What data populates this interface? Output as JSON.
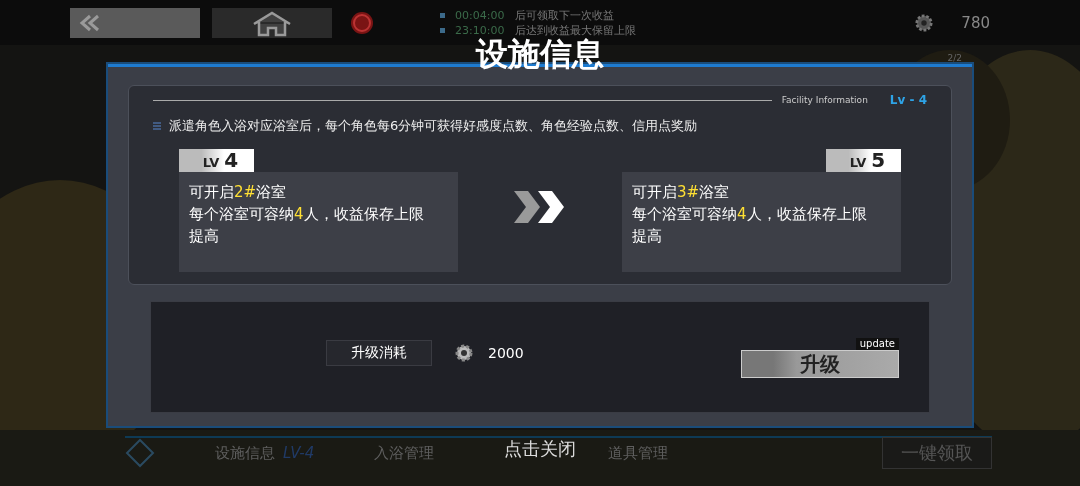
{
  "top_bar": {
    "timers": [
      {
        "time": "00:04:00",
        "text": "后可领取下一次收益"
      },
      {
        "time": "23:10:00",
        "text": "后达到收益最大保留上限"
      }
    ],
    "currency": "780"
  },
  "modal": {
    "title": "设施信息",
    "page": "2/2",
    "subtitle": "Facility Information",
    "level": "Lv - 4",
    "description": "派遣角色入浴对应浴室后，每个角色每6分钟可获得好感度点数、角色经验点数、信用点奖励",
    "cards": [
      {
        "lv_label": "LV",
        "lv": "4",
        "lines": [
          "可开启**2#**浴室",
          "每个浴室可容纳**4**人，收益保存上限提高"
        ]
      },
      {
        "lv_label": "LV",
        "lv": "5",
        "lines": [
          "可开启**3#**浴室",
          "每个浴室可容纳**4**人，收益保存上限提高"
        ]
      }
    ],
    "cost_label": "升级消耗",
    "cost": "2000",
    "upgrade": {
      "label": "升级",
      "tag": "update"
    }
  },
  "close_hint": "点击关闭",
  "bottom_tabs": [
    {
      "label": "设施信息",
      "badge": "LV-4"
    },
    {
      "label": "入浴管理"
    },
    {
      "label": "道具管理"
    }
  ],
  "collect_all": "一键领取"
}
